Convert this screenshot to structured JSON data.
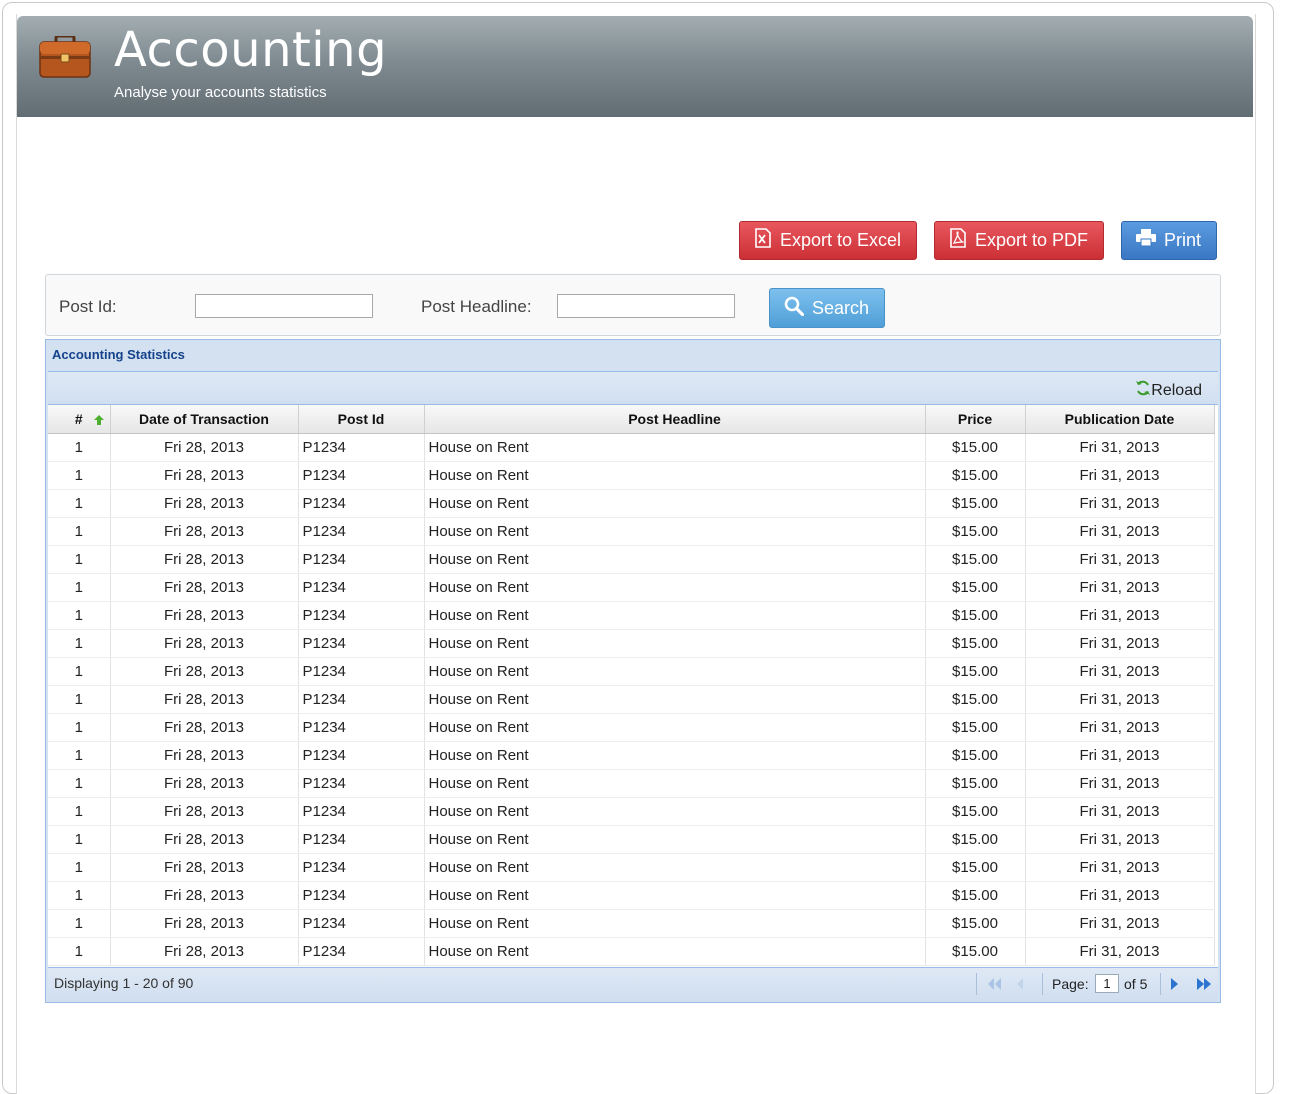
{
  "header": {
    "title": "Accounting",
    "subtitle": "Analyse your accounts statistics"
  },
  "actions": {
    "export_excel": "Export to Excel",
    "export_pdf": "Export to PDF",
    "print": "Print"
  },
  "filters": {
    "post_id_label": "Post Id:",
    "post_id_value": "",
    "post_headline_label": "Post Headline:",
    "post_headline_value": "",
    "search_label": "Search"
  },
  "grid": {
    "title": "Accounting Statistics",
    "reload_label": "Reload",
    "columns": [
      "#",
      "Date of Transaction",
      "Post Id",
      "Post Headline",
      "Price",
      "Publication Date"
    ],
    "rows": [
      [
        "1",
        "Fri 28, 2013",
        "P1234",
        "House on Rent",
        "$15.00",
        "Fri 31, 2013"
      ],
      [
        "1",
        "Fri 28, 2013",
        "P1234",
        "House on Rent",
        "$15.00",
        "Fri 31, 2013"
      ],
      [
        "1",
        "Fri 28, 2013",
        "P1234",
        "House on Rent",
        "$15.00",
        "Fri 31, 2013"
      ],
      [
        "1",
        "Fri 28, 2013",
        "P1234",
        "House on Rent",
        "$15.00",
        "Fri 31, 2013"
      ],
      [
        "1",
        "Fri 28, 2013",
        "P1234",
        "House on Rent",
        "$15.00",
        "Fri 31, 2013"
      ],
      [
        "1",
        "Fri 28, 2013",
        "P1234",
        "House on Rent",
        "$15.00",
        "Fri 31, 2013"
      ],
      [
        "1",
        "Fri 28, 2013",
        "P1234",
        "House on Rent",
        "$15.00",
        "Fri 31, 2013"
      ],
      [
        "1",
        "Fri 28, 2013",
        "P1234",
        "House on Rent",
        "$15.00",
        "Fri 31, 2013"
      ],
      [
        "1",
        "Fri 28, 2013",
        "P1234",
        "House on Rent",
        "$15.00",
        "Fri 31, 2013"
      ],
      [
        "1",
        "Fri 28, 2013",
        "P1234",
        "House on Rent",
        "$15.00",
        "Fri 31, 2013"
      ],
      [
        "1",
        "Fri 28, 2013",
        "P1234",
        "House on Rent",
        "$15.00",
        "Fri 31, 2013"
      ],
      [
        "1",
        "Fri 28, 2013",
        "P1234",
        "House on Rent",
        "$15.00",
        "Fri 31, 2013"
      ],
      [
        "1",
        "Fri 28, 2013",
        "P1234",
        "House on Rent",
        "$15.00",
        "Fri 31, 2013"
      ],
      [
        "1",
        "Fri 28, 2013",
        "P1234",
        "House on Rent",
        "$15.00",
        "Fri 31, 2013"
      ],
      [
        "1",
        "Fri 28, 2013",
        "P1234",
        "House on Rent",
        "$15.00",
        "Fri 31, 2013"
      ],
      [
        "1",
        "Fri 28, 2013",
        "P1234",
        "House on Rent",
        "$15.00",
        "Fri 31, 2013"
      ],
      [
        "1",
        "Fri 28, 2013",
        "P1234",
        "House on Rent",
        "$15.00",
        "Fri 31, 2013"
      ],
      [
        "1",
        "Fri 28, 2013",
        "P1234",
        "House on Rent",
        "$15.00",
        "Fri 31, 2013"
      ],
      [
        "1",
        "Fri 28, 2013",
        "P1234",
        "House on Rent",
        "$15.00",
        "Fri 31, 2013"
      ]
    ],
    "sort_icon": "sort-ascending-icon"
  },
  "pager": {
    "display_text": "Displaying 1 - 20 of 90",
    "page_label": "Page:",
    "current_page": "1",
    "of_pages": "of 5"
  },
  "colors": {
    "header_bg": "#7f8b91",
    "danger": "#d9373e",
    "primary": "#3f7dc9",
    "search": "#5faee3",
    "grid_title": "#15428b"
  }
}
